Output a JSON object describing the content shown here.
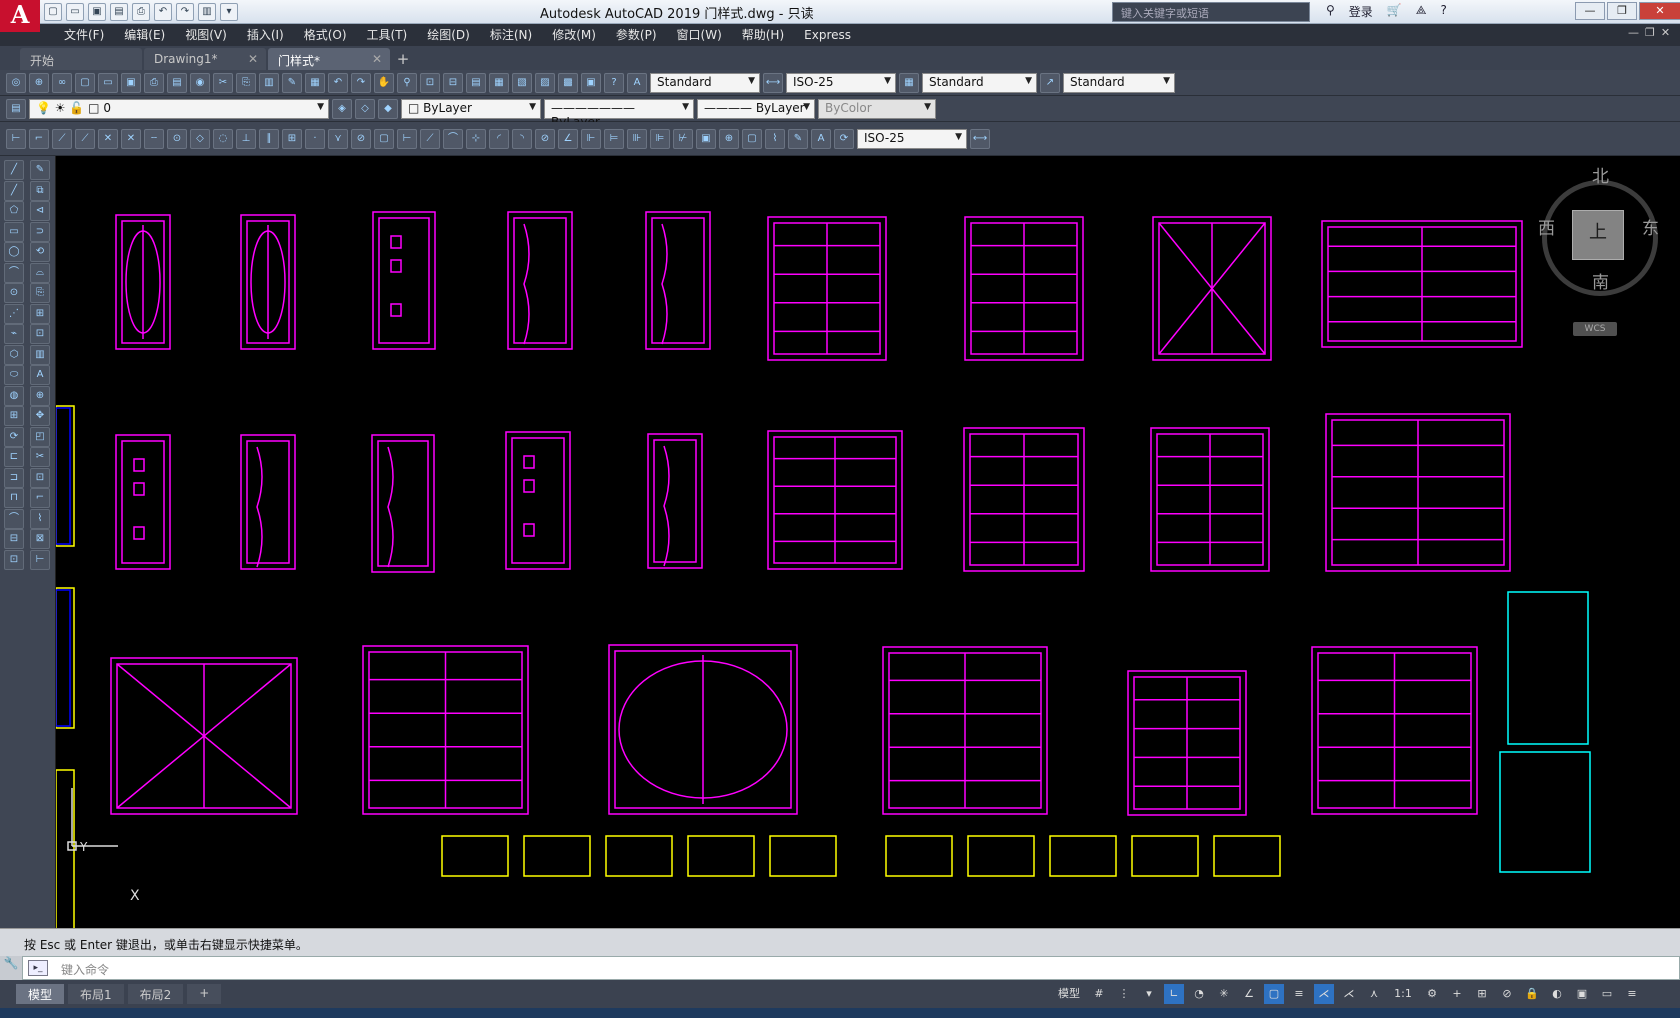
{
  "title": "Autodesk AutoCAD 2019    门样式.dwg - 只读",
  "search": {
    "placeholder": "键入关键字或短语"
  },
  "user": {
    "login": "登录"
  },
  "menus": [
    "文件(F)",
    "编辑(E)",
    "视图(V)",
    "插入(I)",
    "格式(O)",
    "工具(T)",
    "绘图(D)",
    "标注(N)",
    "修改(M)",
    "参数(P)",
    "窗口(W)",
    "帮助(H)",
    "Express"
  ],
  "tabs": [
    {
      "label": "开始",
      "closable": false
    },
    {
      "label": "Drawing1*",
      "closable": true
    },
    {
      "label": "门样式*",
      "closable": true,
      "active": true
    }
  ],
  "toolbar1": {
    "text_style": "Standard",
    "dim_style": "ISO-25",
    "table_style": "Standard",
    "mleader_style": "Standard"
  },
  "toolbar2": {
    "layer": "0",
    "color": "ByLayer",
    "linetype": "ByLayer",
    "lineweight": "ByLayer",
    "plot_style": "ByColor"
  },
  "toolbar3": {
    "dim_style": "ISO-25"
  },
  "compass": {
    "north": "北",
    "south": "南",
    "east": "东",
    "west": "西",
    "top": "上",
    "wcs": "WCS"
  },
  "ucs": {
    "x": "X",
    "y": "Y"
  },
  "command": {
    "history": "按 Esc 或 Enter 键退出，或单击右键显示快捷菜单。",
    "placeholder": "键入命令"
  },
  "layout_tabs": [
    "模型",
    "布局1",
    "布局2"
  ],
  "status": {
    "model": "模型",
    "scale": "1:1"
  },
  "colors": {
    "door": "#ff00ff",
    "frame_yellow": "#ffff00",
    "frame_blue": "#0000ff",
    "cyan": "#00ffff",
    "bg": "#000000"
  }
}
